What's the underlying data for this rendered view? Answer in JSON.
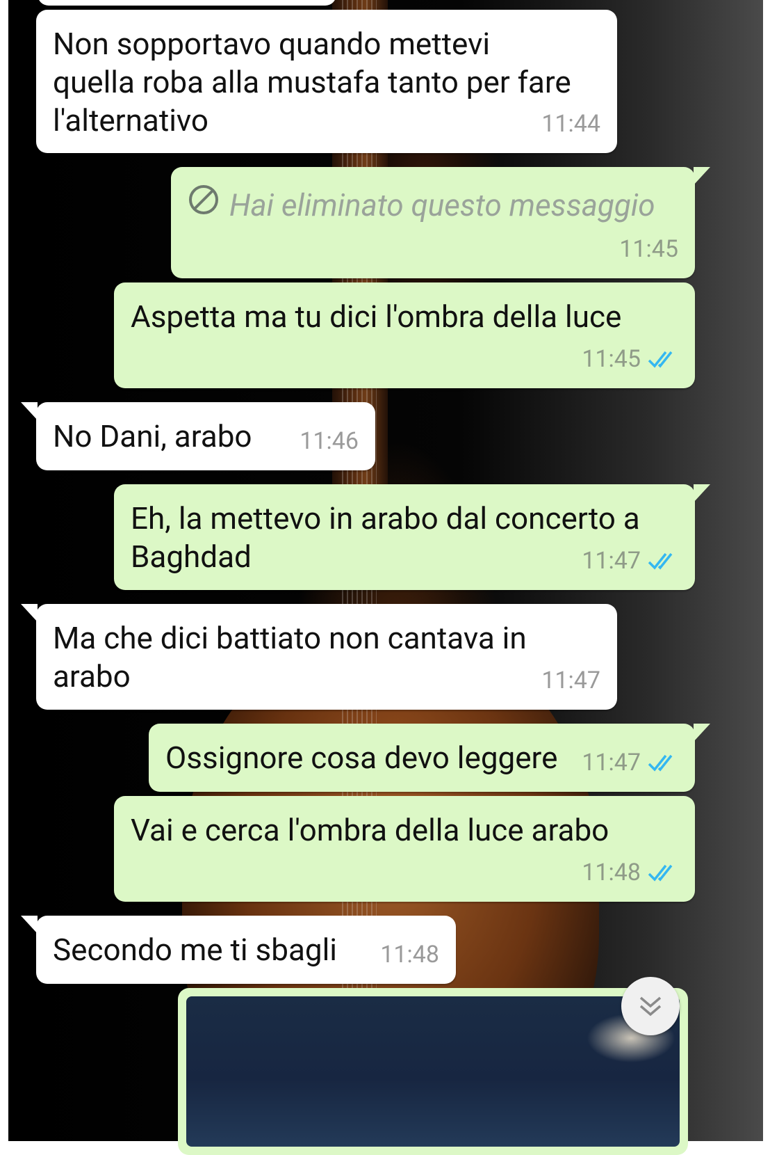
{
  "messages": [
    {
      "dir": "in",
      "text": "Non sopportavo quando mettevi\nquella roba alla mustafa tanto per fare\nl'alternativo",
      "time": "11:44"
    },
    {
      "dir": "out",
      "deleted": true,
      "text": "Hai eliminato questo messaggio",
      "time": "11:45"
    },
    {
      "dir": "out",
      "text": "Aspetta ma tu dici l'ombra della luce",
      "time": "11:45",
      "status": "read"
    },
    {
      "dir": "in",
      "text": "No Dani, arabo",
      "time": "11:46"
    },
    {
      "dir": "out",
      "text": "Eh, la mettevo in arabo dal concerto a\nBaghdad",
      "time": "11:47",
      "status": "read"
    },
    {
      "dir": "in",
      "text": "Ma che dici battiato non cantava in\narabo",
      "time": "11:47"
    },
    {
      "dir": "out",
      "text": "Ossignore cosa devo leggere",
      "time": "11:47",
      "status": "read"
    },
    {
      "dir": "out",
      "text": "Vai e cerca l'ombra della luce arabo",
      "time": "11:48",
      "status": "read"
    },
    {
      "dir": "in",
      "text": "Secondo me ti sbagli",
      "time": "11:48"
    }
  ],
  "icons": {
    "deleted": "block-icon",
    "read_receipt": "double-check-icon",
    "scroll_down": "chevron-double-down-icon"
  },
  "colors": {
    "incoming_bubble": "#ffffff",
    "outgoing_bubble": "#dcf8c6",
    "read_tick": "#34b7f1"
  }
}
